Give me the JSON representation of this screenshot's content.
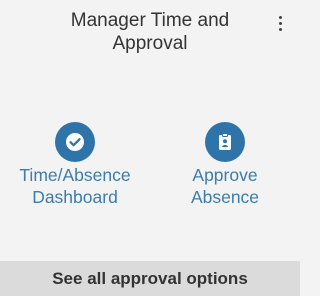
{
  "header": {
    "title": "Manager Time and Approval",
    "menu_icon": "more-vertical-icon"
  },
  "tiles": [
    {
      "label_line1": "Time/Absence",
      "label_line2": "Dashboard",
      "icon": "check-circle-icon"
    },
    {
      "label_line1": "Approve",
      "label_line2": "Absence",
      "icon": "clipboard-user-icon"
    }
  ],
  "footer": {
    "label": "See all approval options"
  },
  "colors": {
    "background": "#f3f3f3",
    "accent": "#2f74a8",
    "label": "#3e7cab",
    "footer_bg": "#dbdbdb",
    "text": "#333333"
  }
}
